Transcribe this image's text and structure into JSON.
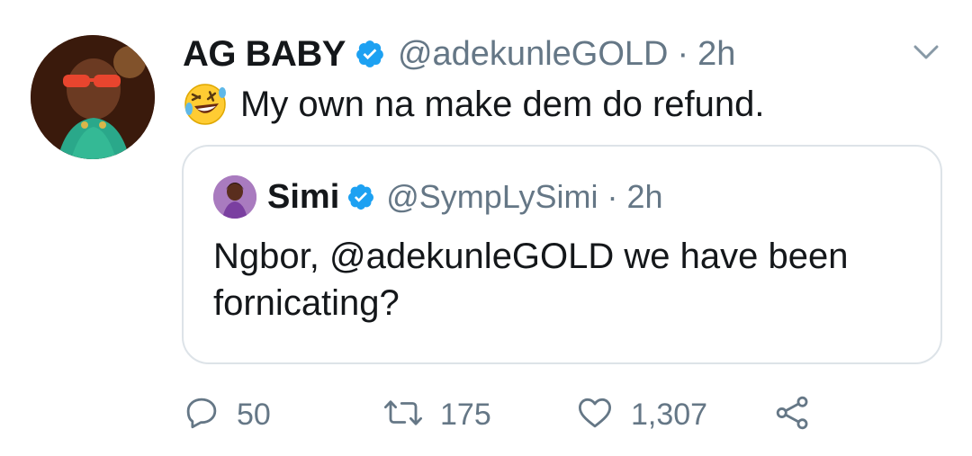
{
  "tweet": {
    "author_name": "AG BABY",
    "author_handle": "@adekunleGOLD",
    "separator": "·",
    "time": "2h",
    "text": "My own na make dem do refund.",
    "emoji": "rolling-on-floor-laughing-emoji",
    "verified": true
  },
  "quote": {
    "author_name": "Simi",
    "author_handle": "@SympLySimi",
    "separator": "·",
    "time": "2h",
    "text": "Ngbor, @adekunleGOLD we have been fornicating?",
    "verified": true
  },
  "actions": {
    "replies": "50",
    "retweets": "175",
    "likes": "1,307"
  },
  "icons": {
    "reply": "reply-icon",
    "retweet": "retweet-icon",
    "like": "heart-icon",
    "share": "share-icon",
    "verified": "verified-badge-icon",
    "menu": "chevron-down-icon"
  },
  "colors": {
    "verified_blue": "#1da1f2",
    "secondary_text": "#657786",
    "border": "#dde3e8",
    "primary_text": "#14171a"
  }
}
